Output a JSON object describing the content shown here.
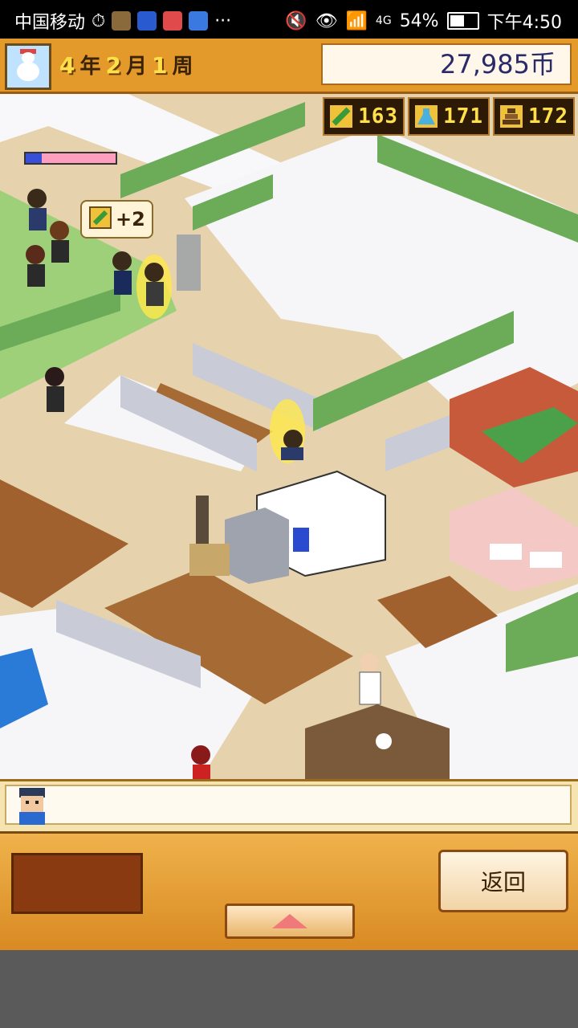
{
  "status_bar": {
    "carrier": "中国移动",
    "network": "4G",
    "battery": "54%",
    "time": "下午4:50"
  },
  "hud": {
    "date": {
      "year_value": "4",
      "year_unit": "年",
      "month_value": "2",
      "month_unit": "月",
      "week_value": "1",
      "week_unit": "周"
    },
    "money": "27,985币"
  },
  "stats": [
    {
      "icon": "pencil-icon",
      "value": "163"
    },
    {
      "icon": "flask-icon",
      "value": "171"
    },
    {
      "icon": "book-stack-icon",
      "value": "172"
    }
  ],
  "popup": {
    "icon": "pencil-icon",
    "value": "+2"
  },
  "student_meter_fraction": 0.18,
  "buttons": {
    "back_label": "返回"
  },
  "colors": {
    "hud_orange": "#e49a2a",
    "stat_gold": "#ffe04a",
    "panel_orange": "#d98a22"
  }
}
